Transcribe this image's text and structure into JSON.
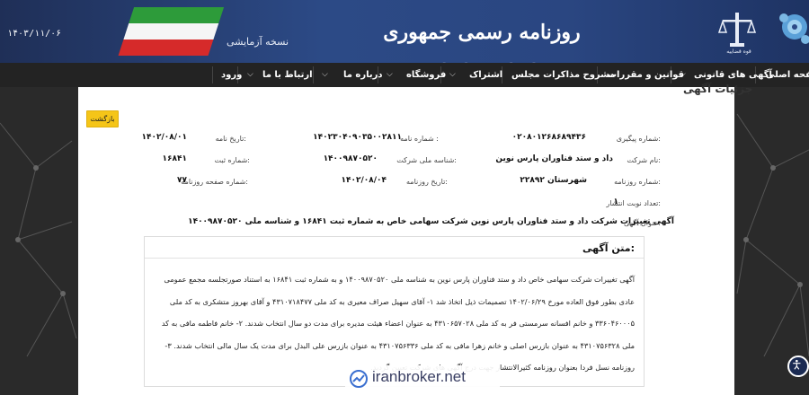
{
  "header": {
    "date": "۱۴۰۳/۱۱/۰۶",
    "trial_label": "نسخه آزمایشی",
    "title": "روزنامه رسمی جمهوری اسلامی ایران",
    "emblem_caption": "قوه قضاییه"
  },
  "nav": {
    "items": [
      "صفحه اصلی",
      "آگهی های قانونی",
      "قوانین و مقررات",
      "مشروح مذاکرات مجلس",
      "اشتراک",
      "فروشگاه",
      "درباره ما",
      "ارتباط با ما",
      "ورود"
    ]
  },
  "page": {
    "heading": "جزئیات آگهی",
    "back_button": "بازگشت"
  },
  "details": {
    "tracking_label": "شماره پیگیری:",
    "tracking_value": "۰۲۰۸۰۱۲۶۸۶۸۹۴۳۶",
    "letter_no_label": "شماره نامه :",
    "letter_no_value": "۱۴۰۲۳۰۴۰۹۰۳۵۰۰۲۸۱۱",
    "letter_date_label": "تاریخ نامه:",
    "letter_date_value": "۱۴۰۲/۰۸/۰۱",
    "company_label": "نام شرکت:",
    "company_value": "داد و ستد فناوران پارس نوین",
    "national_id_label": "شناسه ملی شرکت:",
    "national_id_value": "۱۴۰۰۹۸۷۰۵۲۰",
    "reg_no_label": "شماره ثبت:",
    "reg_no_value": "۱۶۸۴۱",
    "newspaper_no_label": "شماره روزنامه:",
    "newspaper_no_value": "۲۲۸۹۲ شهرستان",
    "newspaper_date_label": "تاریخ روزنامه:",
    "newspaper_date_value": "۱۴۰۲/۰۸/۰۴",
    "page_no_label": "شماره صفحه روزنامه:",
    "page_no_value": "۷۷",
    "publish_count_label": "تعداد نوبت انتشار:",
    "publish_count_value": "۱",
    "ad_title_label": "عنوان آگهی:",
    "ad_title_value": "آگهی تغییرات شرکت داد و ستد فناوران پارس نوین شرکت سهامی خاص به شماره ثبت ۱۶۸۴۱ و شناسه ملی ۱۴۰۰۹۸۷۰۵۲۰"
  },
  "ad_text": {
    "title": "متن آگهی:",
    "body": "آگهی تغییرات شرکت سهامی خاص داد و ستد فناوران پارس نوین به شناسه ملی ۱۴۰۰۹۸۷۰۵۲۰ و به شماره ثبت ۱۶۸۴۱ به استناد صورتجلسه مجمع عمومی عادی بطور فوق العاده مورخ ۱۴۰۲/۰۶/۲۹ تصمیمات ذیل اتخاذ شد ۱- آقای سهیل صراف معیری به کد ملی ۴۳۱۰۷۱۸۴۷۷ و آقای بهروز متشکری به کد ملی ۳۳۶۰۴۶۰۰۰۵ و خانم افسانه سرمستی فر به کد ملی ۴۳۱۰۶۵۷۰۲۸ به عنوان اعضاء هیئت مدیره برای مدت دو سال انتخاب شدند. ۲- خانم فاطمه مافی به کد ملی ۴۳۱۰۷۵۶۳۲۸ به عنوان بازرس اصلی و خانم زهرا مافی به کد ملی ۴۳۱۰۷۵۶۳۳۶ به عنوان بازرس علی البدل برای مدت یک سال مالی انتخاب شدند. ۳- روزنامه نسل فردا بعنوان روزنامه کثیرالانتشار جهت درج آگهی های شرکت تعیین گردید."
  },
  "watermark": "iranbroker.net",
  "colors": {
    "banner": "#2c4a86",
    "nav": "#232323",
    "back_button": "#f5c518",
    "background": "#2a2a2a"
  }
}
